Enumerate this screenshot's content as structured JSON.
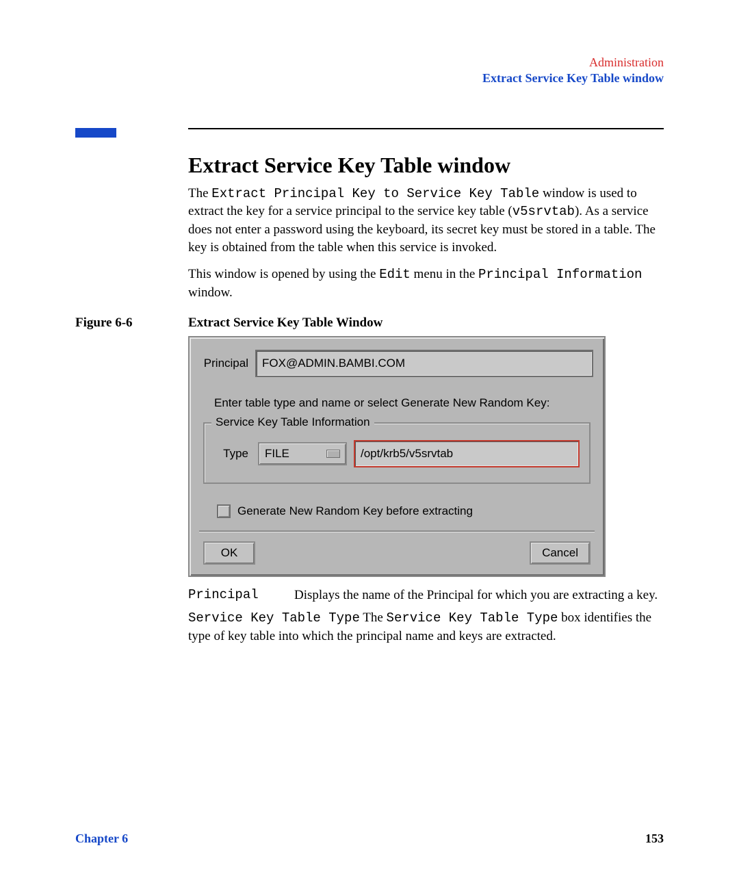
{
  "header": {
    "line1": "Administration",
    "line2": "Extract Service Key Table window"
  },
  "title": "Extract Service Key Table window",
  "para1_a": "The ",
  "para1_b": "Extract Principal Key to Service Key Table",
  "para1_c": " window is used to extract the key for a service principal to the service key table (",
  "para1_d": "v5srvtab",
  "para1_e": "). As a service does not enter a password using the keyboard, its secret key must be stored in a table. The key is obtained from the table when this service is invoked.",
  "para2_a": "This window is opened by using the ",
  "para2_b": "Edit",
  "para2_c": " menu in the ",
  "para2_d": "Principal Information",
  "para2_e": " window.",
  "figure": {
    "num": "Figure 6-6",
    "caption": "Extract Service Key Table Window"
  },
  "dialog": {
    "principal_label": "Principal",
    "principal_value": "FOX@ADMIN.BAMBI.COM",
    "instruction": "Enter table type and name or select Generate New Random Key:",
    "group_title": "Service Key Table Information",
    "type_label": "Type",
    "type_value": "FILE",
    "path_value": "/opt/krb5/v5srvtab",
    "gen_label": "Generate New Random Key before extracting",
    "ok": "OK",
    "cancel": "Cancel"
  },
  "defs": {
    "d1_term": "Principal",
    "d1_body": "Displays the name of the Principal for which you are extracting a key.",
    "d2_term": "Service Key Table Type",
    "d2_a": " The ",
    "d2_b": "Service Key Table Type",
    "d2_c": " box identifies the type of key table into which the principal name and keys are extracted."
  },
  "footer": {
    "left": "Chapter 6",
    "right": "153"
  }
}
